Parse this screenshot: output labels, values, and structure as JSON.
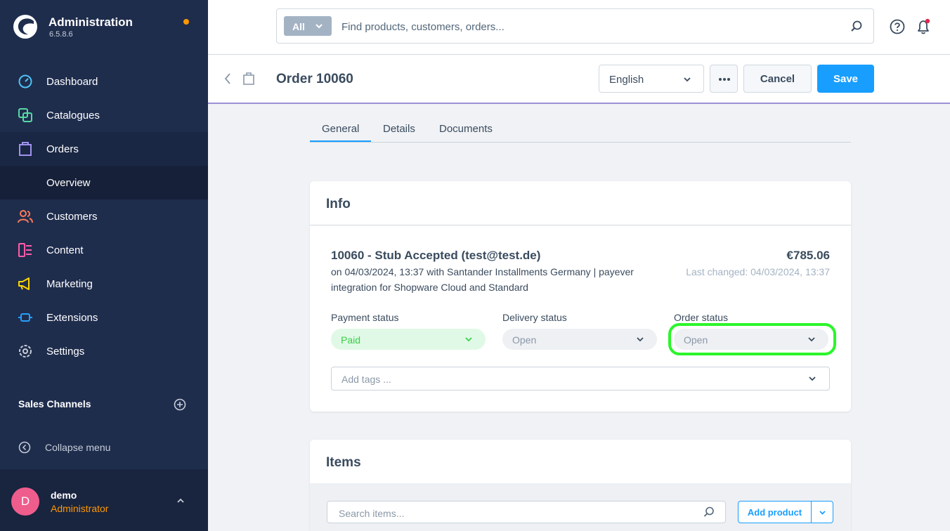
{
  "app": {
    "title": "Administration",
    "version": "6.5.8.6"
  },
  "sidebar": {
    "items": [
      {
        "label": "Dashboard",
        "icon": "dashboard-icon"
      },
      {
        "label": "Catalogues",
        "icon": "catalogue-icon"
      },
      {
        "label": "Orders",
        "icon": "orders-icon"
      },
      {
        "label": "Customers",
        "icon": "customers-icon"
      },
      {
        "label": "Content",
        "icon": "content-icon"
      },
      {
        "label": "Marketing",
        "icon": "marketing-icon"
      },
      {
        "label": "Extensions",
        "icon": "extensions-icon"
      },
      {
        "label": "Settings",
        "icon": "settings-icon"
      }
    ],
    "sub_item": "Overview",
    "sales_channels_title": "Sales Channels",
    "collapse_label": "Collapse menu"
  },
  "user": {
    "initial": "D",
    "name": "demo",
    "role": "Administrator"
  },
  "search": {
    "type_label": "All",
    "placeholder": "Find products, customers, orders..."
  },
  "smartbar": {
    "title": "Order 10060",
    "language": "English",
    "cancel_label": "Cancel",
    "save_label": "Save"
  },
  "tabs": [
    {
      "label": "General",
      "active": true
    },
    {
      "label": "Details",
      "active": false
    },
    {
      "label": "Documents",
      "active": false
    }
  ],
  "info": {
    "title": "Info",
    "summary_title": "10060 - Stub Accepted (test@test.de)",
    "summary_line1": "on 04/03/2024, 13:37 with Santander Installments Germany | payever",
    "summary_line2": "integration for Shopware Cloud and Standard",
    "amount": "€785.06",
    "last_changed": "Last changed: 04/03/2024, 13:37",
    "payment_status_label": "Payment status",
    "payment_status_value": "Paid",
    "delivery_status_label": "Delivery status",
    "delivery_status_value": "Open",
    "order_status_label": "Order status",
    "order_status_value": "Open",
    "tags_placeholder": "Add tags ..."
  },
  "items": {
    "title": "Items",
    "search_placeholder": "Search items...",
    "add_product_label": "Add product"
  },
  "colors": {
    "sidebar_bg": "#1f2d4d",
    "accent": "#189eff",
    "paid_green": "#37d046",
    "highlight": "#2bf52b",
    "user_role": "#ff9800"
  }
}
